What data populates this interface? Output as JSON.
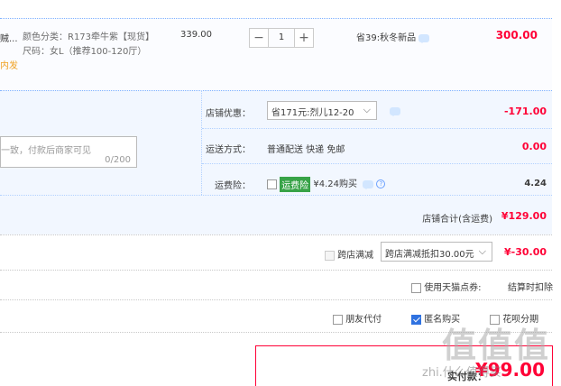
{
  "item": {
    "title_fragment": "贼...",
    "color_line": "颜色分类：R173牵牛紫【现货】",
    "size_line": "尺码：女L（推荐100-120厅）",
    "orange_fragment": "内发",
    "unit_price": "339.00",
    "quantity": "1",
    "qty_minus": "−",
    "qty_plus": "+",
    "save_tag": "省39:秋冬新品",
    "total": "300.00"
  },
  "shop": {
    "discount_label": "店铺优惠：",
    "discount_selected": "省171元:烈儿12-20",
    "discount_amount": "-171.00",
    "message_placeholder": "一致，付款后商家可见",
    "message_counter": "0/200",
    "shipping_label": "运送方式：",
    "shipping_value": "普通配送 快递 免邮",
    "shipping_amount": "0.00",
    "insurance_label": "运费险：",
    "insurance_tag": "运费险",
    "insurance_price": "¥4.24购买",
    "insurance_amount": "4.24",
    "total_label": "店铺合计(含运费)",
    "total_amount": "¥129.00"
  },
  "cross_store": {
    "label": "跨店满减",
    "selected": "跨店满减抵扣30.00元",
    "amount": "¥-30.00"
  },
  "points": {
    "label": "使用天猫点券:",
    "note": "结算时扣除"
  },
  "options": {
    "friend_pay": "朋友代付",
    "anonymous": "匿名购买",
    "huabei": "花呗分期"
  },
  "payment": {
    "label": "实付款：",
    "amount": "¥99.00"
  },
  "watermark": {
    "logo": "值值值",
    "site": "zhi.什么值得买"
  },
  "colors": {
    "accent_red": "#ff0036",
    "link_blue": "#2f72e0",
    "row_bg": "#f2f7ff"
  }
}
